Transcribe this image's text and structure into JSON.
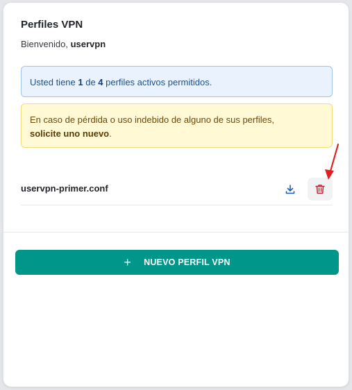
{
  "card": {
    "title": "Perfiles VPN",
    "welcome_prefix": "Bienvenido, ",
    "username": "uservpn"
  },
  "info_alert": {
    "prefix": "Usted tiene ",
    "active_count": "1",
    "middle": " de ",
    "max_count": "4",
    "suffix": " perfiles activos permitidos."
  },
  "warning_alert": {
    "text": "En caso de pérdida o uso indebido de alguno de sus perfiles,",
    "link_text": "solicite uno nuevo",
    "end": "."
  },
  "profiles": [
    {
      "filename": "uservpn-primer.conf",
      "download_icon": "download-icon",
      "delete_icon": "trash-icon"
    }
  ],
  "actions": {
    "new_profile_icon": "+",
    "new_profile_label": "NUEVO PERFIL VPN"
  },
  "colors": {
    "primary": "#00968a",
    "info_bg": "#eaf3fd",
    "info_border": "#9fc6ec",
    "warning_bg": "#fff9d6",
    "warning_border": "#f2dd7b",
    "danger": "#b02a37",
    "download": "#1f5fae",
    "annotation_arrow": "#e02020"
  }
}
